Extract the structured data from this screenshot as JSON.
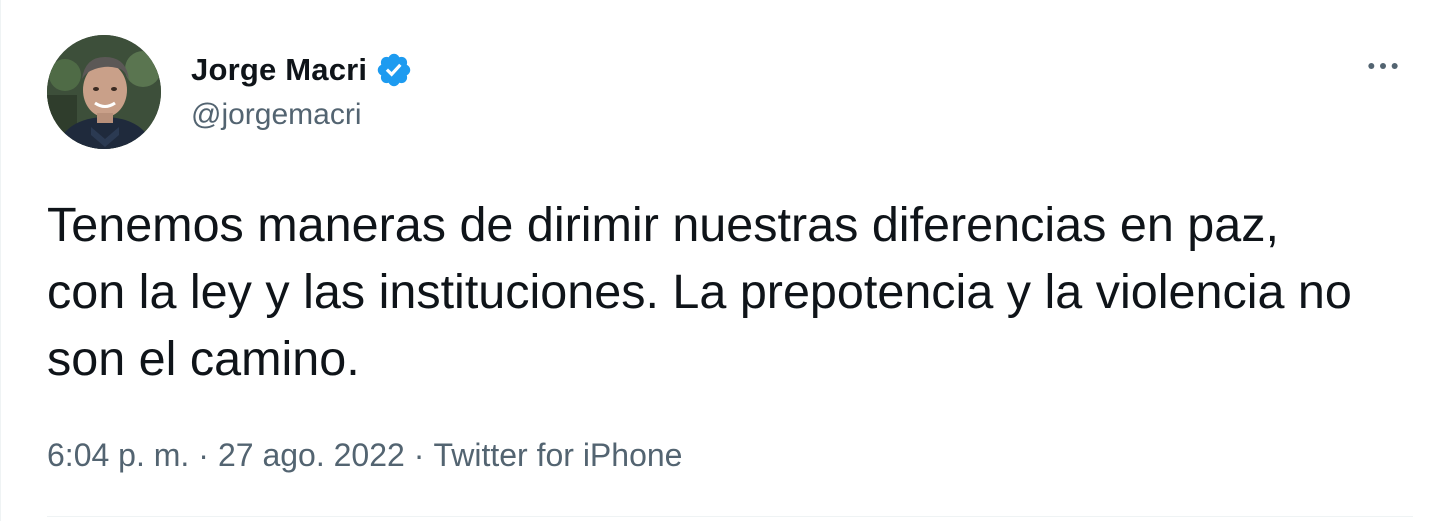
{
  "author": {
    "display_name": "Jorge Macri",
    "handle": "@jorgemacri",
    "verified": true,
    "verified_icon": "verified-badge-icon",
    "verified_color": "#1d9bf0"
  },
  "tweet": {
    "text": "Tenemos maneras de dirimir nuestras diferencias en paz, con la ley y las instituciones. La prepotencia y la violencia no son el camino.",
    "time": "6:04 p. m.",
    "separator": "·",
    "date": "27 ago. 2022",
    "source": "Twitter for iPhone"
  },
  "actions": {
    "more_icon": "more-dots-icon"
  },
  "colors": {
    "text_primary": "#0f1419",
    "text_secondary": "#536471",
    "divider": "#eff3f4"
  }
}
